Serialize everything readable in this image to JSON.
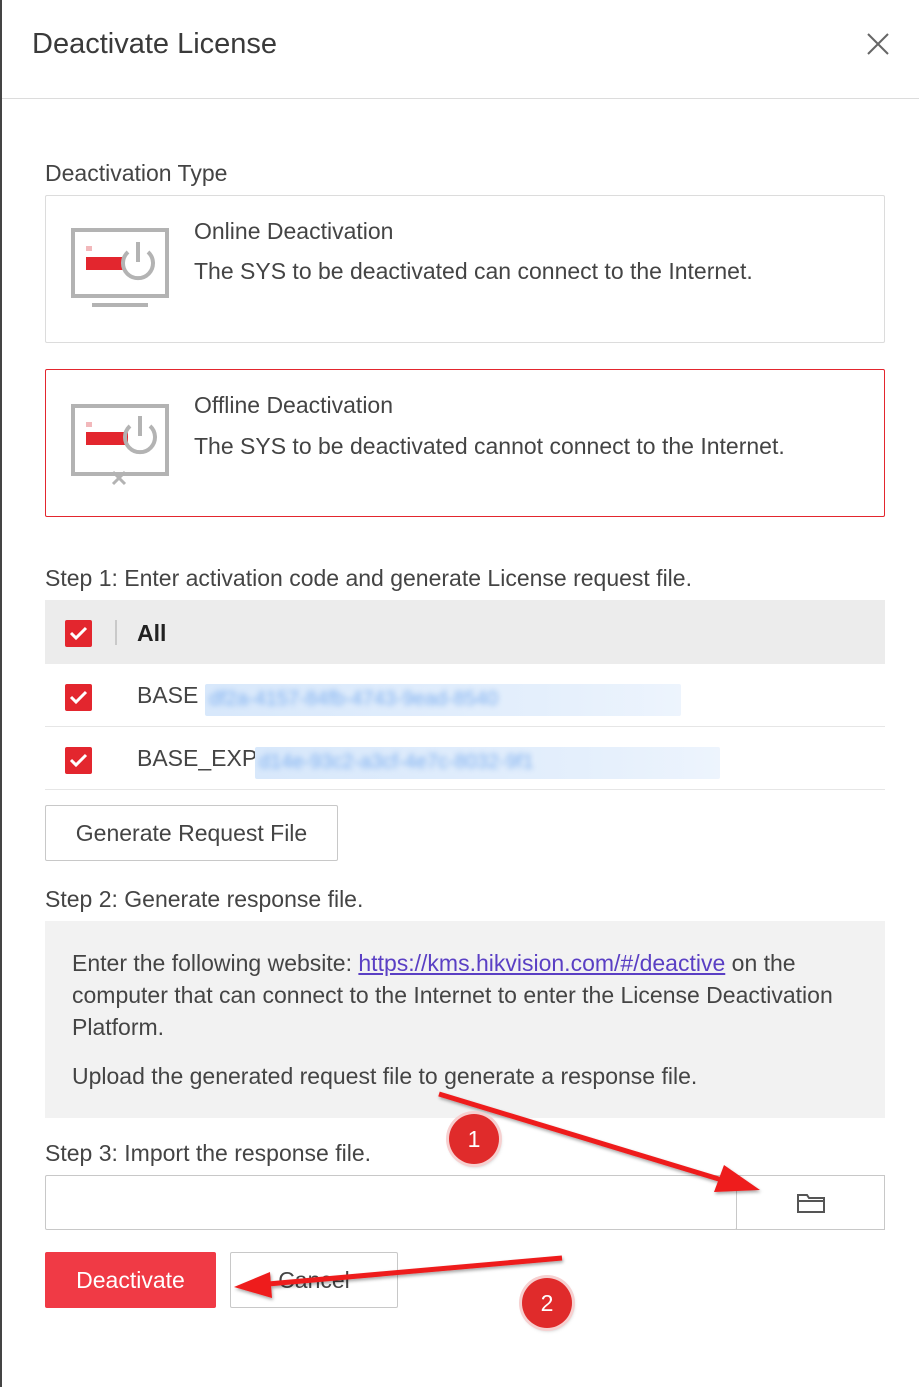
{
  "dialog": {
    "title": "Deactivate License",
    "close_icon": "close-icon"
  },
  "deactivation_type": {
    "label": "Deactivation Type",
    "options": [
      {
        "name": "Online Deactivation",
        "description": "The SYS to be deactivated can connect to the Internet.",
        "icon": "monitor-power-icon",
        "selected": false
      },
      {
        "name": "Offline Deactivation",
        "description": "The SYS to be deactivated cannot connect to the Internet.",
        "icon": "monitor-power-offline-icon",
        "selected": true
      }
    ]
  },
  "step1": {
    "label": "Step 1: Enter activation code and generate License request file.",
    "table": {
      "header": {
        "label": "All",
        "checked": true
      },
      "rows": [
        {
          "name": "BASE",
          "code": "df2a-4157-84fb-4743-9ead-8540",
          "checked": true
        },
        {
          "name": "BASE_EXP",
          "code": "d14e-93c2-a3cf-4e7c-8032-9f1",
          "checked": true
        }
      ]
    },
    "generate_button": "Generate Request File"
  },
  "step2": {
    "label": "Step 2: Generate response file.",
    "info_prefix": "Enter the following website: ",
    "info_link": "https://kms.hikvision.com/#/deactive",
    "info_suffix": " on the computer that can connect to the Internet to enter the License Deactivation Platform.",
    "info_line2": "Upload the generated request file to generate a response file."
  },
  "step3": {
    "label": "Step 3: Import the response file.",
    "file_value": "",
    "browse_icon": "folder-icon"
  },
  "footer": {
    "deactivate_button": "Deactivate",
    "cancel_button": "Cancel"
  },
  "annotations": {
    "badge1": "1",
    "badge2": "2",
    "color": "#e02b2b"
  },
  "colors": {
    "accent": "#e3262e",
    "primary_button": "#f03a45",
    "link": "#5a3fc4"
  }
}
